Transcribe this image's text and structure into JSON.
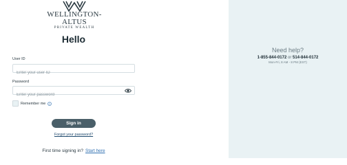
{
  "brand": {
    "name": "WELLINGTON-ALTUS",
    "tagline": "PRIVATE WEALTH"
  },
  "login": {
    "heading": "Hello",
    "user_id_label": "User ID",
    "user_id_placeholder": "Enter your user ID",
    "password_label": "Password",
    "password_placeholder": "Enter your password",
    "remember_label": "Remember me",
    "signin_label": "Sign in",
    "forgot_label": "Forgot your password?",
    "first_time_text": "First time signing in?",
    "start_here_label": "Start here"
  },
  "help": {
    "title": "Need help?",
    "phone1": "1-855-844-0172",
    "or": "or",
    "phone2": "514-844-0172",
    "hours": "Mon-Fri, 8 AM - 8 PM (EST)"
  },
  "colors": {
    "panel_bg": "#e9f2f4",
    "button_bg": "#4a5f69",
    "link": "#2f6fb0"
  },
  "icons": [
    "wellington-altus-logo-icon",
    "eye-icon",
    "info-icon"
  ]
}
